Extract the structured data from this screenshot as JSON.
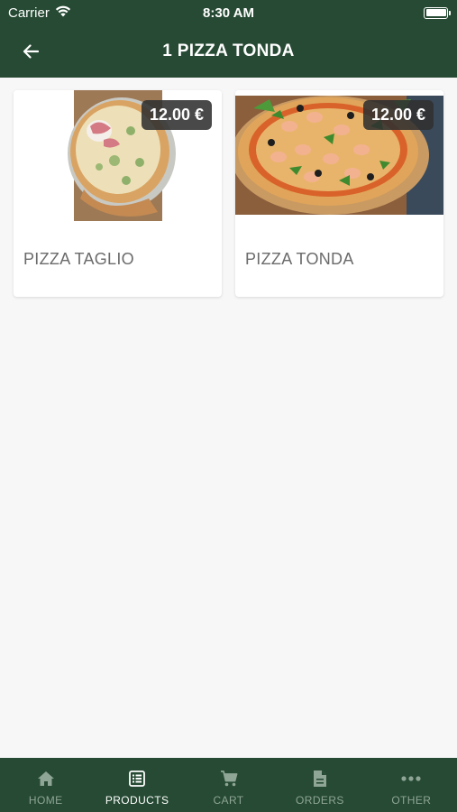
{
  "status_bar": {
    "carrier": "Carrier",
    "time": "8:30 AM"
  },
  "app_bar": {
    "title": "1 PIZZA TONDA"
  },
  "products": [
    {
      "name": "PIZZA TAGLIO",
      "price": "12.00 €"
    },
    {
      "name": "PIZZA TONDA",
      "price": "12.00 €"
    }
  ],
  "bottom_nav": {
    "items": [
      {
        "label": "HOME",
        "icon": "home-icon",
        "active": false
      },
      {
        "label": "PRODUCTS",
        "icon": "list-icon",
        "active": true
      },
      {
        "label": "CART",
        "icon": "cart-icon",
        "active": false
      },
      {
        "label": "ORDERS",
        "icon": "document-icon",
        "active": false
      },
      {
        "label": "OTHER",
        "icon": "more-icon",
        "active": false
      }
    ]
  },
  "colors": {
    "primary": "#264a33",
    "inactive_nav": "#8fa596",
    "background": "#f7f7f7"
  }
}
